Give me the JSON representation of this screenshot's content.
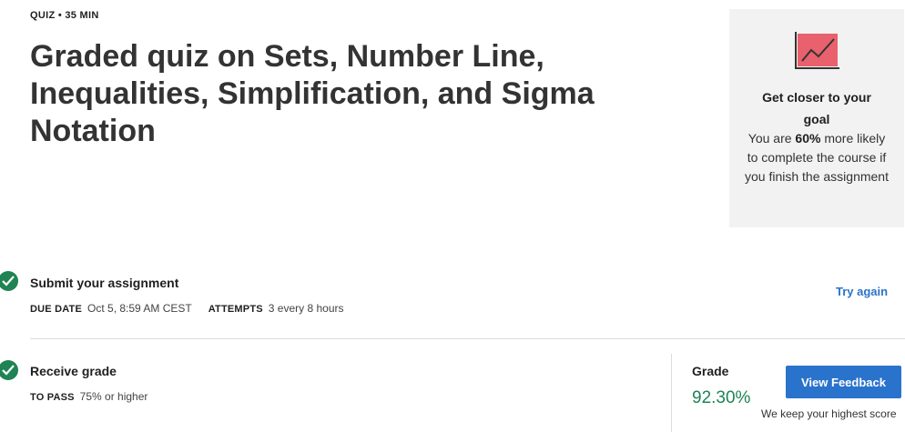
{
  "header": {
    "meta": "QUIZ • 35 MIN",
    "title": "Graded quiz on Sets, Number Line, Inequalities, Simplification, and Sigma Notation"
  },
  "goal_card": {
    "icon": "chart-trend-icon",
    "heading": "Get closer to your goal",
    "text_before": "You are ",
    "highlight": "60%",
    "text_after": " more likely to complete the course if you finish the assignment"
  },
  "submit_row": {
    "title": "Submit your assignment",
    "due_label": "DUE DATE",
    "due_value": "Oct 5, 8:59 AM CEST",
    "attempts_label": "ATTEMPTS",
    "attempts_value": "3 every 8 hours",
    "action": "Try again"
  },
  "grade_row": {
    "title": "Receive grade",
    "pass_label": "TO PASS",
    "pass_value": "75% or higher",
    "grade_label": "Grade",
    "grade_value": "92.30%",
    "button": "View Feedback",
    "note": "We keep your highest score"
  },
  "colors": {
    "accent": "#2a73cc",
    "success": "#1f8354",
    "card_bg": "#f2f2f2",
    "chart_fill": "#e8616c"
  }
}
